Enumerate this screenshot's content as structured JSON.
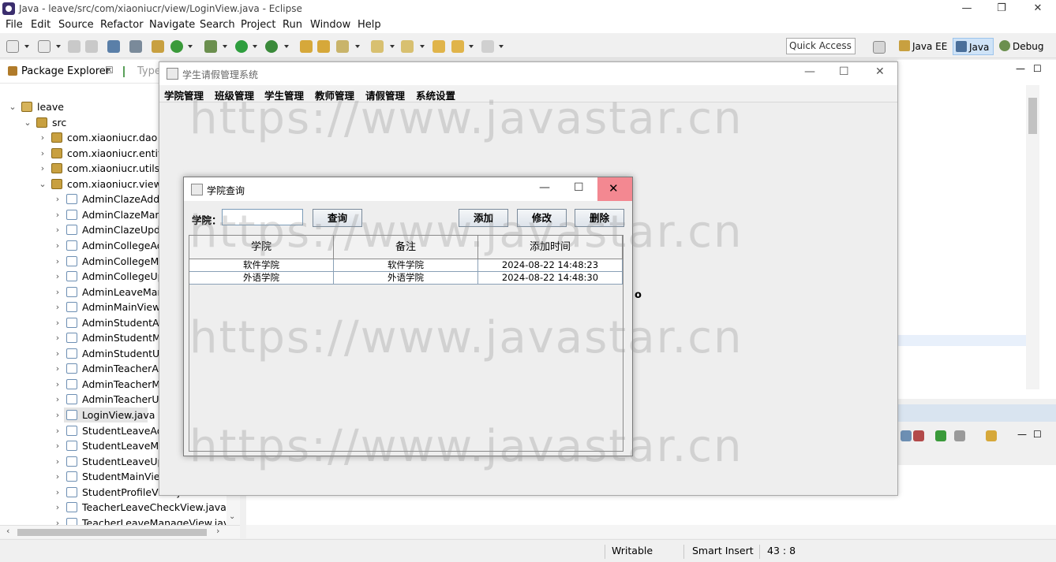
{
  "eclipse": {
    "title": "Java - leave/src/com/xiaoniucr/view/LoginView.java - Eclipse",
    "menu": [
      "File",
      "Edit",
      "Source",
      "Refactor",
      "Navigate",
      "Search",
      "Project",
      "Run",
      "Window",
      "Help"
    ],
    "quick_access": "Quick Access",
    "perspectives": [
      {
        "label": "Java EE"
      },
      {
        "label": "Java"
      },
      {
        "label": "Debug"
      }
    ]
  },
  "package_explorer": {
    "tab_label": "Package Explorer",
    "tab_close": "☒",
    "other_tab": "Type",
    "tree": [
      {
        "label": "leave",
        "type": "project",
        "level": 0,
        "arrow": "v"
      },
      {
        "label": "src",
        "type": "folder",
        "level": 1,
        "arrow": "v"
      },
      {
        "label": "com.xiaoniucr.dao",
        "type": "package",
        "level": 2,
        "arrow": ">"
      },
      {
        "label": "com.xiaoniucr.entity",
        "type": "package",
        "level": 2,
        "arrow": ">"
      },
      {
        "label": "com.xiaoniucr.utils",
        "type": "package",
        "level": 2,
        "arrow": ">"
      },
      {
        "label": "com.xiaoniucr.view",
        "type": "package",
        "level": 2,
        "arrow": "v"
      },
      {
        "label": "AdminClazeAddV",
        "type": "java",
        "level": 3,
        "arrow": ">"
      },
      {
        "label": "AdminClazeMana",
        "type": "java",
        "level": 3,
        "arrow": ">"
      },
      {
        "label": "AdminClazeUpda",
        "type": "java",
        "level": 3,
        "arrow": ">"
      },
      {
        "label": "AdminCollegeAdc",
        "type": "java",
        "level": 3,
        "arrow": ">"
      },
      {
        "label": "AdminCollegeMa",
        "type": "java",
        "level": 3,
        "arrow": ">"
      },
      {
        "label": "AdminCollegeUpc",
        "type": "java",
        "level": 3,
        "arrow": ">"
      },
      {
        "label": "AdminLeaveMana",
        "type": "java",
        "level": 3,
        "arrow": ">"
      },
      {
        "label": "AdminMainView.j",
        "type": "java",
        "level": 3,
        "arrow": ">"
      },
      {
        "label": "AdminStudentAdc",
        "type": "java",
        "level": 3,
        "arrow": ">"
      },
      {
        "label": "AdminStudentMa",
        "type": "java",
        "level": 3,
        "arrow": ">"
      },
      {
        "label": "AdminStudentUpc",
        "type": "java",
        "level": 3,
        "arrow": ">"
      },
      {
        "label": "AdminTeacherAd",
        "type": "java",
        "level": 3,
        "arrow": ">"
      },
      {
        "label": "AdminTeacherMa",
        "type": "java",
        "level": 3,
        "arrow": ">"
      },
      {
        "label": "AdminTeacherUp",
        "type": "java",
        "level": 3,
        "arrow": ">"
      },
      {
        "label": "LoginView.java",
        "type": "java",
        "level": 3,
        "arrow": ">",
        "selected": true
      },
      {
        "label": "StudentLeaveAdd",
        "type": "java",
        "level": 3,
        "arrow": ">"
      },
      {
        "label": "StudentLeaveMar",
        "type": "java",
        "level": 3,
        "arrow": ">"
      },
      {
        "label": "StudentLeaveUpc",
        "type": "java",
        "level": 3,
        "arrow": ">"
      },
      {
        "label": "StudentMainView",
        "type": "java",
        "level": 3,
        "arrow": ">"
      },
      {
        "label": "StudentProfileView.java",
        "type": "java",
        "level": 3,
        "arrow": ">"
      },
      {
        "label": "TeacherLeaveCheckView.java",
        "type": "java",
        "level": 3,
        "arrow": ">"
      },
      {
        "label": "TeacherLeaveManageView.java",
        "type": "java",
        "level": 3,
        "arrow": ">"
      }
    ]
  },
  "statusbar": {
    "writable": "Writable",
    "insert_mode": "Smart Insert",
    "position": "43 : 8"
  },
  "main_window": {
    "title": "学生请假管理系统",
    "menu": [
      "学院管理",
      "班级管理",
      "学生管理",
      "教师管理",
      "请假管理",
      "系统设置"
    ],
    "stray_char": "o"
  },
  "dialog": {
    "title": "学院查询",
    "college_label": "学院：",
    "college_input_value": "",
    "search_button": "查询",
    "add_button": "添加",
    "edit_button": "修改",
    "delete_button": "删除",
    "table": {
      "columns": [
        "学院",
        "备注",
        "添加时间"
      ],
      "rows": [
        [
          "软件学院",
          "软件学院",
          "2024-08-22 14:48:23"
        ],
        [
          "外语学院",
          "外语学院",
          "2024-08-22 14:48:30"
        ]
      ]
    }
  },
  "watermark": "https://www.javastar.cn",
  "controls": {
    "minimize": "—",
    "maximize": "☐",
    "restore": "❐",
    "close": "✕"
  }
}
